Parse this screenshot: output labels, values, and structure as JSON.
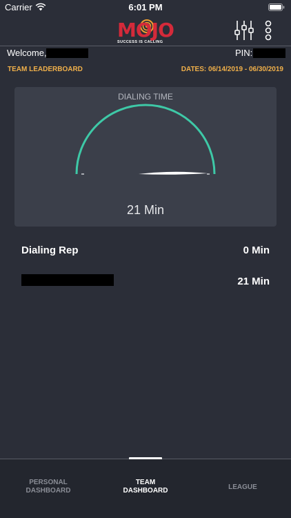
{
  "status_bar": {
    "carrier": "Carrier",
    "time": "6:01 PM",
    "icons": [
      "wifi-icon",
      "battery-icon"
    ]
  },
  "header": {
    "logo": {
      "word": "MOJO",
      "tagline": "SUCCESS IS CALLING",
      "brand_color": "#d42a3a",
      "ring_color": "#f0a030"
    },
    "icons": [
      "sliders-icon",
      "more-options-icon"
    ]
  },
  "user": {
    "welcome_label": "Welcome,",
    "pin_label": "PIN:"
  },
  "leaderboard": {
    "title": "TEAM LEADERBOARD",
    "dates": "DATES: 06/14/2019 - 06/30/2019",
    "accent_color": "#f0b04a"
  },
  "gauge": {
    "title": "DIALING TIME",
    "value_text": "21 Min",
    "arc_color": "#3ec9a7",
    "needle_fraction": 0.0
  },
  "reps": [
    {
      "name": "Dialing Rep",
      "value": "0 Min"
    },
    {
      "name": "",
      "value": "21 Min"
    }
  ],
  "tabs": [
    {
      "line1": "PERSONAL",
      "line2": "DASHBOARD",
      "active": false
    },
    {
      "line1": "TEAM",
      "line2": "DASHBOARD",
      "active": true
    },
    {
      "line1": "LEAGUE",
      "line2": "",
      "active": false
    }
  ],
  "colors": {
    "background": "#2b2e38",
    "card": "#3b3f4a",
    "tab_bar": "#23262e"
  }
}
